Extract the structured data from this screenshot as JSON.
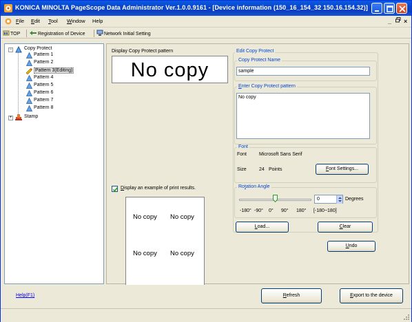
{
  "window": {
    "title": "KONICA MINOLTA PageScope Data Administrator Ver.1.0.0.9161 - [Device information (150_16_154_32 150.16.154.32)]"
  },
  "menu": {
    "items": [
      {
        "label": "File",
        "u": "F",
        "rest": "ile"
      },
      {
        "label": "Edit",
        "u": "E",
        "rest": "dit"
      },
      {
        "label": "Tool",
        "u": "T",
        "rest": "ool"
      },
      {
        "label": "Window",
        "u": "W",
        "rest": "indow"
      },
      {
        "label": "Help",
        "u": "",
        "rest": "Help"
      }
    ],
    "mdi_controls": {
      "minimize": "_",
      "restore": "ɑ",
      "close": "×"
    }
  },
  "toolbar": {
    "top": "TOP",
    "registration": "Registration of Device",
    "network": "Network Initial Setting"
  },
  "tree": {
    "copy_protect": "Copy Protect",
    "patterns": [
      "Pattern 1",
      "Pattern 2",
      "Pattern 3(Editing)",
      "Pattern 4",
      "Pattern 5",
      "Pattern 6",
      "Pattern 7",
      "Pattern 8"
    ],
    "stamp": "Stamp"
  },
  "main": {
    "display_pattern_label": "Display Copy Protect pattern",
    "pattern_preview_text": "No copy",
    "display_example_label": "Display an example of print results.",
    "display_example_underline": "D",
    "display_example_rest": "isplay an example of print results.",
    "display_example_checked": true,
    "print_preview": [
      "No copy",
      "No copy",
      "No copy",
      "No copy"
    ]
  },
  "edit": {
    "group_title": "Edit Copy Protect",
    "name_label": "Copy Protect Name",
    "name_value": "sample",
    "pattern_label_u": "E",
    "pattern_label_pre": "E",
    "pattern_label_rest": "nter Copy Protect pattern",
    "pattern_value": "No copy",
    "font": {
      "title": "Font",
      "font_label": "Font",
      "font_value": "Microsoft Sans Serif",
      "size_label": "Size",
      "size_value": "24",
      "size_unit": "Points",
      "settings_button_u": "F",
      "settings_button_rest": "ont Settings..."
    },
    "rotation": {
      "title_pre": "Ro",
      "title_u": "t",
      "title_rest": "ation Angle",
      "value": "0",
      "unit": "Degrees",
      "ticks": [
        "-180°",
        "-90°",
        "0°",
        "90°",
        "180°",
        "[-180~180]"
      ]
    },
    "load_button_u": "L",
    "load_button_rest": "oad...",
    "clear_button_u": "C",
    "clear_button_rest": "lear",
    "undo_button_u": "U",
    "undo_button_rest": "ndo"
  },
  "footer": {
    "help_link": "Help(F1)",
    "refresh_u": "R",
    "refresh_rest": "efresh",
    "export_u": "E",
    "export_rest": "xport to the device"
  }
}
